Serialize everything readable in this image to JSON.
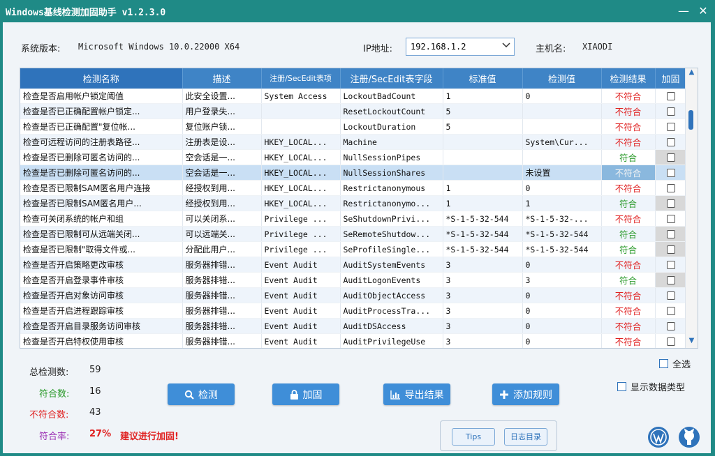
{
  "window": {
    "title": "Windows基线检测加固助手 v1.2.3.0"
  },
  "header": {
    "os_label": "系统版本:",
    "os_value": "Microsoft Windows 10.0.22000 X64",
    "ip_label": "IP地址:",
    "ip_value": "192.168.1.2",
    "host_label": "主机名:",
    "host_value": "XIAODI"
  },
  "grid": {
    "columns": [
      "检测名称",
      "描述",
      "注册/SecEdit表项",
      "注册/SecEdit表字段",
      "标准值",
      "检测值",
      "检测结果",
      "加固"
    ],
    "rows": [
      {
        "name": "检查是否启用帐户锁定阈值",
        "desc": "此安全设置...",
        "key": "System Access",
        "field": "LockoutBadCount",
        "std": "1",
        "val": "0",
        "result": "不符合",
        "fix": "",
        "status": "bad",
        "fixdim": false
      },
      {
        "name": "检查是否已正确配置帐户锁定...",
        "desc": "用户登录失...",
        "key": "",
        "field": "ResetLockoutCount",
        "std": "5",
        "val": "",
        "result": "不符合",
        "fix": "",
        "status": "bad",
        "fixdim": false
      },
      {
        "name": "检查是否已正确配置\"复位帐...",
        "desc": "复位账户锁...",
        "key": "",
        "field": "LockoutDuration",
        "std": "5",
        "val": "",
        "result": "不符合",
        "fix": "",
        "status": "bad",
        "fixdim": false
      },
      {
        "name": "检查可远程访问的注册表路径...",
        "desc": "注册表是设...",
        "key": "HKEY_LOCAL...",
        "field": "Machine",
        "std": "",
        "val": "System\\Cur...",
        "result": "不符合",
        "fix": "",
        "status": "bad",
        "fixdim": false
      },
      {
        "name": "检查是否已删除可匿名访问的...",
        "desc": "空会话是一...",
        "key": "HKEY_LOCAL...",
        "field": "NullSessionPipes",
        "std": "",
        "val": "",
        "result": "符合",
        "fix": "",
        "status": "ok",
        "fixdim": true
      },
      {
        "name": "检查是否已删除可匿名访问的...",
        "desc": "空会话是一...",
        "key": "HKEY_LOCAL...",
        "field": "NullSessionShares",
        "std": "",
        "val": "未设置",
        "result": "不符合",
        "fix": "",
        "status": "bad",
        "fixdim": false
      },
      {
        "name": "检查是否已限制SAM匿名用户连接",
        "desc": "经授权到用...",
        "key": "HKEY_LOCAL...",
        "field": "Restrictanonymous",
        "std": "1",
        "val": "0",
        "result": "不符合",
        "fix": "",
        "status": "bad",
        "fixdim": false
      },
      {
        "name": "检查是否已限制SAM匿名用户...",
        "desc": "经授权到用...",
        "key": "HKEY_LOCAL...",
        "field": "Restrictanonymo...",
        "std": "1",
        "val": "1",
        "result": "符合",
        "fix": "",
        "status": "ok",
        "fixdim": true
      },
      {
        "name": "检查可关闭系统的帐户和组",
        "desc": "可以关闭系...",
        "key": "Privilege ...",
        "field": "SeShutdownPrivi...",
        "std": "*S-1-5-32-544",
        "val": "*S-1-5-32-...",
        "result": "不符合",
        "fix": "",
        "status": "bad",
        "fixdim": false
      },
      {
        "name": "检查是否已限制可从远端关闭...",
        "desc": "可以远端关...",
        "key": "Privilege ...",
        "field": "SeRemoteShutdow...",
        "std": "*S-1-5-32-544",
        "val": "*S-1-5-32-544",
        "result": "符合",
        "fix": "",
        "status": "ok",
        "fixdim": true
      },
      {
        "name": "检查是否已限制\"取得文件或...",
        "desc": "分配此用户...",
        "key": "Privilege ...",
        "field": "SeProfileSingle...",
        "std": "*S-1-5-32-544",
        "val": "*S-1-5-32-544",
        "result": "符合",
        "fix": "",
        "status": "ok",
        "fixdim": true
      },
      {
        "name": "检查是否开启策略更改审核",
        "desc": "服务器排错...",
        "key": "Event Audit",
        "field": "AuditSystemEvents",
        "std": "3",
        "val": "0",
        "result": "不符合",
        "fix": "",
        "status": "bad",
        "fixdim": false
      },
      {
        "name": "检查是否开启登录事件审核",
        "desc": "服务器排错...",
        "key": "Event Audit",
        "field": "AuditLogonEvents",
        "std": "3",
        "val": "3",
        "result": "符合",
        "fix": "",
        "status": "ok",
        "fixdim": true
      },
      {
        "name": "检查是否开启对象访问审核",
        "desc": "服务器排错...",
        "key": "Event Audit",
        "field": "AuditObjectAccess",
        "std": "3",
        "val": "0",
        "result": "不符合",
        "fix": "",
        "status": "bad",
        "fixdim": false
      },
      {
        "name": "检查是否开启进程跟踪审核",
        "desc": "服务器排错...",
        "key": "Event Audit",
        "field": "AuditProcessTra...",
        "std": "3",
        "val": "0",
        "result": "不符合",
        "fix": "",
        "status": "bad",
        "fixdim": false
      },
      {
        "name": "检查是否开启目录服务访问审核",
        "desc": "服务器排错...",
        "key": "Event Audit",
        "field": "AuditDSAccess",
        "std": "3",
        "val": "0",
        "result": "不符合",
        "fix": "",
        "status": "bad",
        "fixdim": false
      },
      {
        "name": "检查是否开启特权使用审核",
        "desc": "服务器排错...",
        "key": "Event Audit",
        "field": "AuditPrivilegeUse",
        "std": "3",
        "val": "0",
        "result": "不符合",
        "fix": "",
        "status": "bad",
        "fixdim": false
      }
    ],
    "selected_row": 5
  },
  "stats": {
    "total_label": "总检测数:",
    "total_value": "59",
    "pass_label": "符合数:",
    "pass_value": "16",
    "fail_label": "不符合数:",
    "fail_value": "43",
    "rate_label": "符合率:",
    "rate_value": "27%",
    "advice": "建议进行加固!"
  },
  "buttons": {
    "scan": "检测",
    "fix": "加固",
    "export": "导出结果",
    "add_rule": "添加规则",
    "tips": "Tips",
    "log_dir": "日志目录"
  },
  "options": {
    "select_all": "全选",
    "show_types": "显示数据类型"
  },
  "colors": {
    "title_bar": "#1f8a86",
    "header": "#3f84c6",
    "button": "#3f8ed8",
    "fail": "#e02020",
    "pass": "#2a9a2a",
    "pass_label": "#2a9a2a",
    "fail_label": "#e02020",
    "rate_label": "#9b2fb3"
  },
  "icons": [
    "search-icon",
    "lock-icon",
    "bar-chart-icon",
    "plus-icon",
    "wordpress-icon",
    "github-icon",
    "minimize-icon",
    "close-icon",
    "chevron-down-icon"
  ]
}
